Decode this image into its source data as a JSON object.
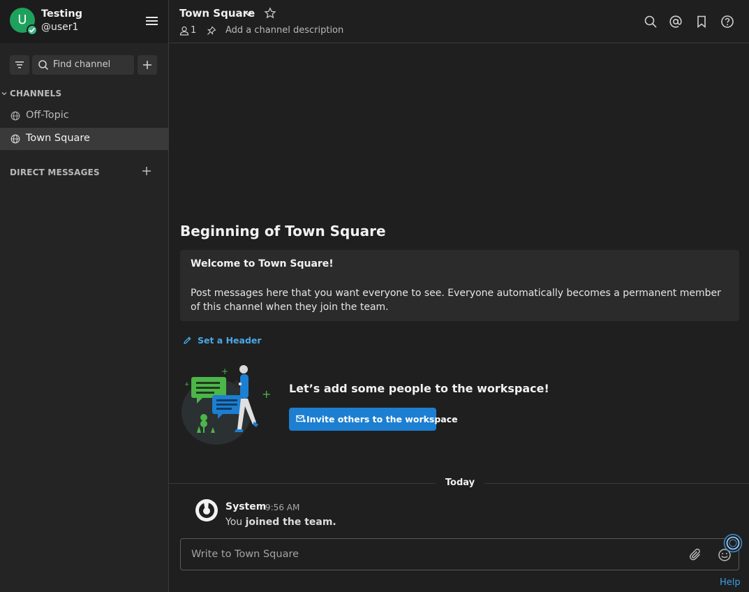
{
  "colors": {
    "sidebar_bg": "#242424",
    "main_bg": "#1f1f1f",
    "accent": "#1c7fd1",
    "link": "#4aa8e8",
    "online": "#3db887"
  },
  "sidebar": {
    "team_name": "Testing",
    "user_initial": "U",
    "username": "@user1",
    "find_channel_placeholder": "Find channel",
    "channels_header": "CHANNELS",
    "channels": [
      {
        "name": "Off-Topic",
        "icon": "globe-icon",
        "active": false
      },
      {
        "name": "Town Square",
        "icon": "globe-icon",
        "active": true
      }
    ],
    "dm_header": "DIRECT MESSAGES"
  },
  "header": {
    "channel_name": "Town Square",
    "member_count": "1",
    "description_placeholder": "Add a channel description",
    "icons": [
      "search-icon",
      "mention-icon",
      "bookmark-icon",
      "help-icon"
    ]
  },
  "intro": {
    "title": "Beginning of Town Square",
    "welcome_title": "Welcome to Town Square!",
    "welcome_body": "Post messages here that you want everyone to see. Everyone automatically becomes a permanent member of this channel when they join the team.",
    "set_header": "Set a Header",
    "invite_title": "Let’s add some people to the workspace!",
    "invite_button": "Invite others to the workspace"
  },
  "feed": {
    "date_separator": "Today",
    "posts": [
      {
        "author": "System",
        "time": "9:56 AM",
        "message_prefix": "You ",
        "message_bold": "joined the team."
      }
    ]
  },
  "composer": {
    "placeholder": "Write to Town Square"
  },
  "footer": {
    "help": "Help"
  }
}
